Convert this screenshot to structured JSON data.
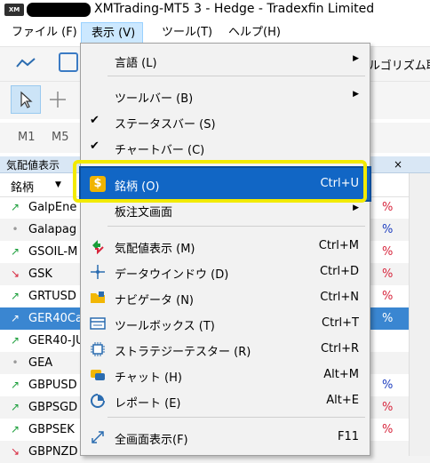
{
  "window": {
    "logo": "XM",
    "title": "XMTrading-MT5 3 - Hedge - Tradexfin Limited"
  },
  "menubar": {
    "items": [
      {
        "label": "ファイル (F)"
      },
      {
        "label": "表示 (V)"
      },
      {
        "label": "ツール(T)"
      },
      {
        "label": "ヘルプ(H)"
      }
    ]
  },
  "toolbar": {
    "right_label": "ルゴリズム取引",
    "timeframes": [
      "M1",
      "M5"
    ]
  },
  "market_watch": {
    "title": "気配値表示",
    "close": "×",
    "symbol_column": "銘柄",
    "rows": [
      {
        "arrow": "↗",
        "dir": "up",
        "symbol": "GalpEne",
        "pct": "%",
        "pct_dir": "down"
      },
      {
        "arrow": "•",
        "dir": "flat",
        "symbol": "Galapag",
        "pct": "%",
        "pct_dir": "up"
      },
      {
        "arrow": "↗",
        "dir": "up",
        "symbol": "GSOIL-M",
        "pct": "%",
        "pct_dir": "down"
      },
      {
        "arrow": "↘",
        "dir": "down",
        "symbol": "GSK",
        "pct": "%",
        "pct_dir": "down"
      },
      {
        "arrow": "↗",
        "dir": "up",
        "symbol": "GRTUSD",
        "pct": "%",
        "pct_dir": "down"
      },
      {
        "arrow": "↗",
        "dir": "up",
        "symbol": "GER40Ca",
        "pct": "%",
        "pct_dir": "up",
        "selected": true
      },
      {
        "arrow": "↗",
        "dir": "up",
        "symbol": "GER40-JU",
        "pct": "",
        "pct_dir": "up"
      },
      {
        "arrow": "•",
        "dir": "flat",
        "symbol": "GEA",
        "pct": "",
        "pct_dir": "up"
      },
      {
        "arrow": "↗",
        "dir": "up",
        "symbol": "GBPUSD",
        "pct": "%",
        "pct_dir": "up"
      },
      {
        "arrow": "↗",
        "dir": "up",
        "symbol": "GBPSGD",
        "pct": "%",
        "pct_dir": "down"
      },
      {
        "arrow": "↗",
        "dir": "up",
        "symbol": "GBPSEK",
        "pct": "%",
        "pct_dir": "down"
      },
      {
        "arrow": "↘",
        "dir": "down",
        "symbol": "GBPNZD",
        "pct": "",
        "pct_dir": "down"
      }
    ]
  },
  "view_menu": {
    "items": [
      {
        "label": "言語 (L)",
        "shortcut": "",
        "submenu": true
      },
      {
        "label": "ツールバー (B)",
        "shortcut": "",
        "submenu": true
      },
      {
        "label": "ステータスバー (S)",
        "shortcut": "",
        "check": "✔"
      },
      {
        "label": "チャートバー (C)",
        "shortcut": "",
        "check": "✔"
      },
      {
        "label": "銘柄 (O)",
        "shortcut": "Ctrl+U",
        "icon": "dollar-icon",
        "icon_char": "$",
        "selected": true
      },
      {
        "label": "板注文画面",
        "shortcut": "",
        "submenu": true
      },
      {
        "label": "気配値表示 (M)",
        "shortcut": "Ctrl+M",
        "icon": "market-watch-icon"
      },
      {
        "label": "データウインドウ (D)",
        "shortcut": "Ctrl+D",
        "icon": "crosshair-icon"
      },
      {
        "label": "ナビゲータ (N)",
        "shortcut": "Ctrl+N",
        "icon": "folder-icon"
      },
      {
        "label": "ツールボックス (T)",
        "shortcut": "Ctrl+T",
        "icon": "toolbox-icon"
      },
      {
        "label": "ストラテジーテスター (R)",
        "shortcut": "Ctrl+R",
        "icon": "chip-icon"
      },
      {
        "label": "チャット (H)",
        "shortcut": "Alt+M",
        "icon": "chat-icon"
      },
      {
        "label": "レポート (E)",
        "shortcut": "Alt+E",
        "icon": "report-icon"
      },
      {
        "label": "全画面表示(F)",
        "shortcut": "F11",
        "icon": "fullscreen-icon"
      }
    ],
    "submenu_glyph": "▶"
  },
  "colors": {
    "highlight_ring": "#f2ea00",
    "selected_item": "#1166c5",
    "menu_open": "#cce8ff"
  }
}
